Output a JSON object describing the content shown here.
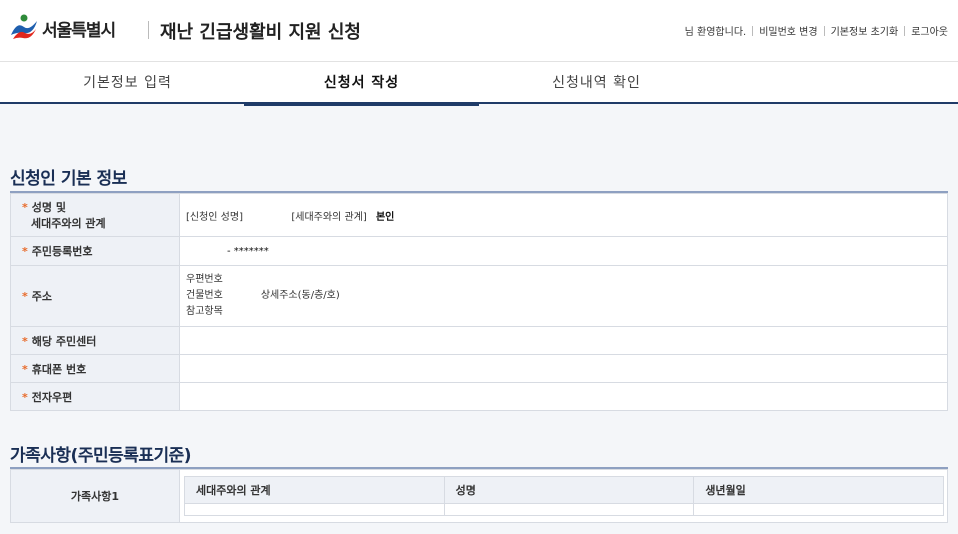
{
  "header": {
    "logo_text": "서울특별시",
    "page_title": "재난 긴급생활비 지원 신청",
    "util": {
      "welcome": "님 환영합니다.",
      "change_password": "비밀번호 변경",
      "reset_info": "기본정보 초기화",
      "logout": "로그아웃"
    }
  },
  "tabs": [
    {
      "label": "기본정보 입력"
    },
    {
      "label": "신청서 작성"
    },
    {
      "label": "신청내역 확인"
    }
  ],
  "applicant": {
    "section_title": "신청인 기본 정보",
    "required_mark": "*",
    "rows": {
      "name_relation_label_1": "성명 및",
      "name_relation_label_2": "세대주와의 관계",
      "applicant_name_label": "[신청인 성명]",
      "householder_relation_label": "[세대주와의 관계]",
      "householder_relation_value": "본인",
      "rrn_label": "주민등록번호",
      "rrn_value": "- *******",
      "address_label": "주소",
      "postal_code_label": "우편번호",
      "building_no_label": "건물번호",
      "detail_address_label": "상세주소(동/층/호)",
      "reference_label": "참고항목",
      "community_center_label": "해당 주민센터",
      "mobile_label": "휴대폰 번호",
      "email_label": "전자우편"
    }
  },
  "family": {
    "section_title": "가족사항(주민등록표기준)",
    "row_label": "가족사항1",
    "columns": [
      "세대주와의 관계",
      "성명",
      "생년월일"
    ]
  }
}
